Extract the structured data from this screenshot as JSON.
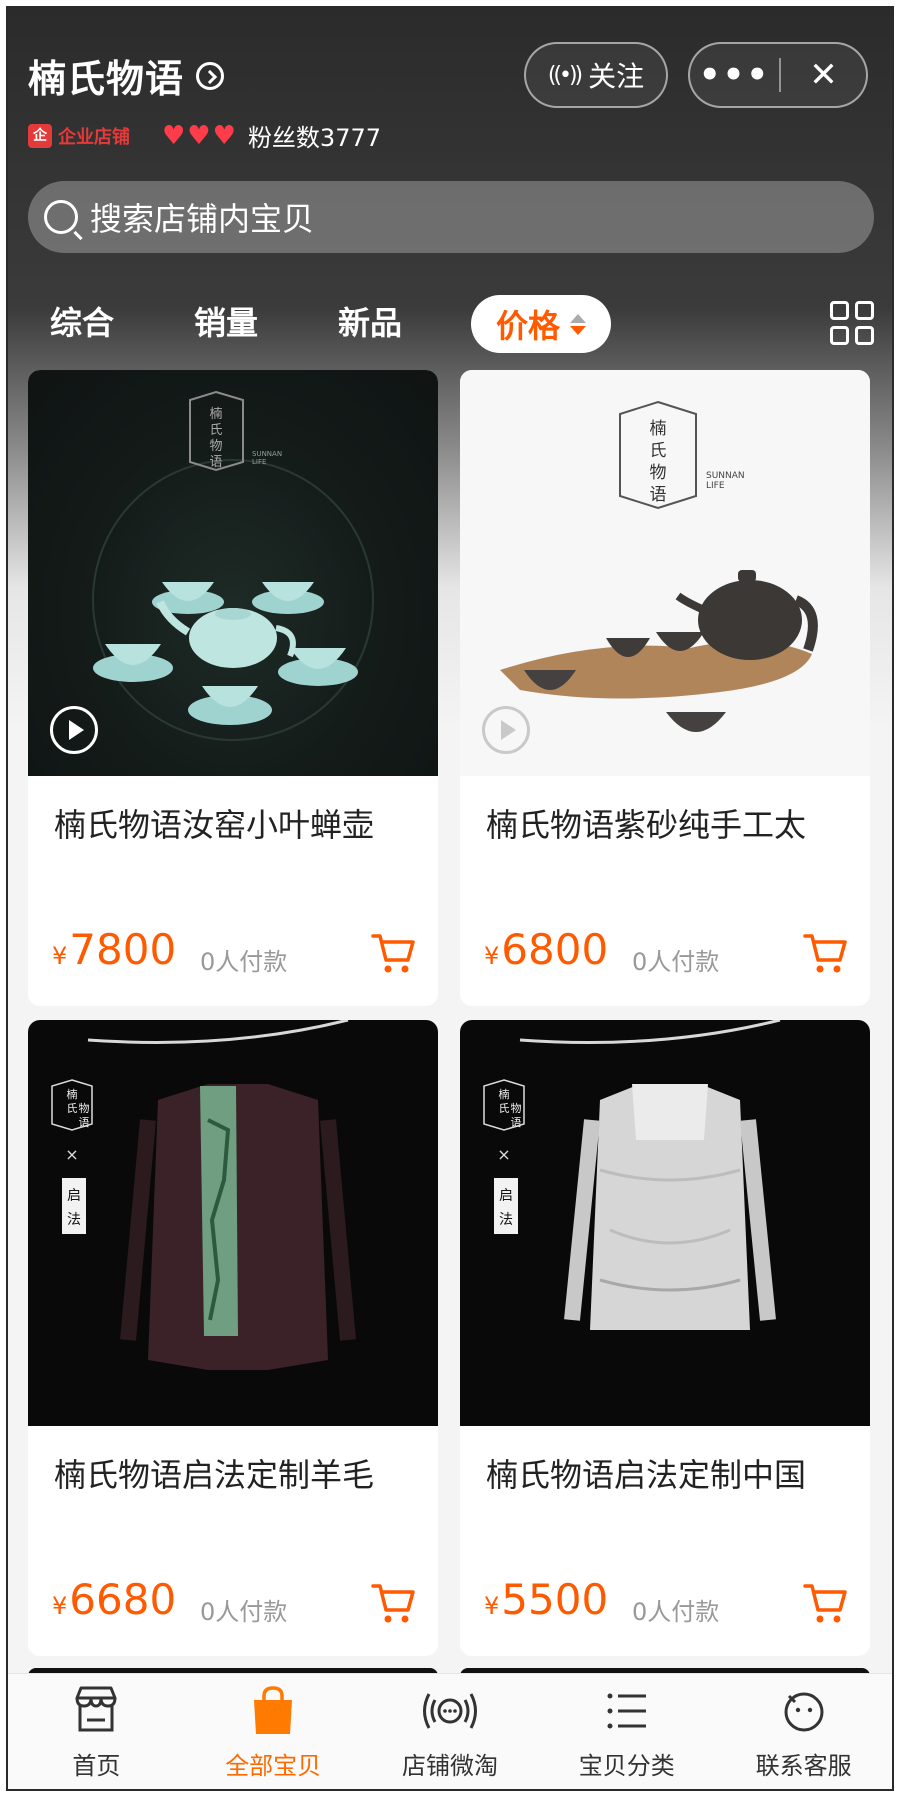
{
  "shop": {
    "name": "楠氏物语",
    "enterprise_badge": "企业店铺",
    "fans": "粉丝数3777"
  },
  "header": {
    "follow_label": "关注",
    "more_label": "•••",
    "close_label": "✕"
  },
  "search": {
    "placeholder": "搜索店铺内宝贝"
  },
  "tabs": [
    {
      "label": "综合"
    },
    {
      "label": "销量"
    },
    {
      "label": "新品"
    },
    {
      "label": "价格"
    }
  ],
  "products": [
    {
      "title": "楠氏物语汝窑小叶蝉壶",
      "currency": "¥",
      "price": "7800",
      "sold": "0人付款"
    },
    {
      "title": "楠氏物语紫砂纯手工太",
      "currency": "¥",
      "price": "6800",
      "sold": "0人付款"
    },
    {
      "title": "楠氏物语启法定制羊毛",
      "currency": "¥",
      "price": "6680",
      "sold": "0人付款"
    },
    {
      "title": "楠氏物语启法定制中国",
      "currency": "¥",
      "price": "5500",
      "sold": "0人付款"
    }
  ],
  "product_images": {
    "logo_chars": [
      "楠",
      "氏",
      "物",
      "语"
    ],
    "brand_en_1": "SUNNAN",
    "brand_en_2": "LIFE",
    "collab_mark": "×",
    "collab_chars": [
      "启",
      "法"
    ]
  },
  "bottom_nav": [
    {
      "label": "首页",
      "icon": "storefront-icon"
    },
    {
      "label": "全部宝贝",
      "icon": "shopping-bag-icon"
    },
    {
      "label": "店铺微淘",
      "icon": "broadcast-icon"
    },
    {
      "label": "宝贝分类",
      "icon": "list-icon"
    },
    {
      "label": "联系客服",
      "icon": "chat-face-icon"
    }
  ],
  "colors": {
    "accent": "#ff5a00",
    "hearts": "#ff3d4a",
    "badge": "#e43a3a"
  }
}
